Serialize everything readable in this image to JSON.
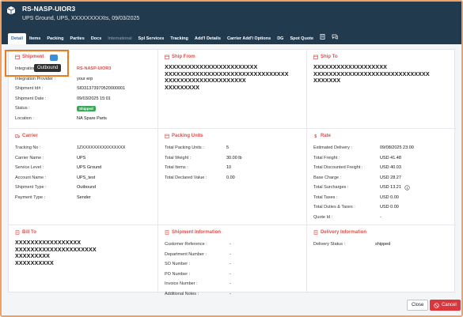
{
  "header": {
    "title": "RS-NASP-UIOR3",
    "subtitle": "UPS Ground, UPS, XXXXXXXXXts, 09/03/2025"
  },
  "tabs": [
    "Detail",
    "Items",
    "Packing",
    "Parties",
    "Docs",
    "International",
    "Spl Services",
    "Tracking",
    "Add'l Details",
    "Carrier Add'l Options",
    "DG",
    "Spot Quote"
  ],
  "shipment": {
    "title": "Shipment",
    "tooltip": "Outbound",
    "rows": [
      {
        "label": "Integration",
        "value": "RS-NASP-UIOR3"
      },
      {
        "label": "Integration Provider :",
        "value": "your erp"
      },
      {
        "label": "Shipment Id# :",
        "value": "SID31373970520000001"
      },
      {
        "label": "Shipment Date :",
        "value": "09/03/2025 15:01"
      },
      {
        "label": "Status :",
        "value": "Shipped"
      },
      {
        "label": "Location :",
        "value": "NA Spare Parts"
      }
    ]
  },
  "ship_from": {
    "title": "Ship From",
    "lines": [
      "XXXXXXXXXXXXXXXXXXXXXXXX",
      "XXXXXXXXXXXXXXXXXXXXXXXXXXXXXXXX",
      "XXXXXXXXXXXXXXXXXXXXX",
      "XXXXXXXXX"
    ]
  },
  "ship_to": {
    "title": "Ship To",
    "lines": [
      "XXXXXXXXXXXXXXXXXXX",
      "XXXXXXXXXXXXXXXXXXXXXXXXXXXXXX",
      "XXXXXXX"
    ]
  },
  "carrier": {
    "title": "Carrier",
    "rows": [
      {
        "label": "Tracking No :",
        "value": "1ZXXXXXXXXXXXXXXX"
      },
      {
        "label": "Carrier Name :",
        "value": "UPS"
      },
      {
        "label": "Service Level :",
        "value": "UPS Ground"
      },
      {
        "label": "Account Name :",
        "value": "UPS_test"
      },
      {
        "label": "Shipment Type :",
        "value": "Outbound"
      },
      {
        "label": "Payment Type :",
        "value": "Sender"
      }
    ]
  },
  "packing": {
    "title": "Packing Units",
    "rows": [
      {
        "label": "Total Packing Units :",
        "value": "5"
      },
      {
        "label": "Total Weight :",
        "value": "30.00 lb"
      },
      {
        "label": "Total Items :",
        "value": "10"
      },
      {
        "label": "Total Declared Value :",
        "value": "0.00"
      }
    ]
  },
  "rate": {
    "title": "Rate",
    "rows": [
      {
        "label": "Estimated Delivery :",
        "value": "09/08/2025 23:00"
      },
      {
        "label": "Total Freight :",
        "value": "USD 41.48"
      },
      {
        "label": "Total Discounted Freight :",
        "value": "USD 40.03"
      },
      {
        "label": "Base Charge :",
        "value": "USD 28.27"
      },
      {
        "label": "Total Surcharges :",
        "value": "USD 13.21"
      },
      {
        "label": "Total Taxes :",
        "value": "USD 0.00"
      },
      {
        "label": "Total Duties & Taxes :",
        "value": "USD 0.00"
      },
      {
        "label": "Quote Id :",
        "value": "-"
      }
    ]
  },
  "bill_to": {
    "title": "Bill To",
    "lines": [
      "XXXXXXXXXXXXXXXXX",
      "XXXXXXXXXXXXXXXXXXXXX",
      "XXXXXXXXX",
      "XXXXXXXXXX"
    ]
  },
  "shipment_info": {
    "title": "Shipment Information",
    "rows": [
      {
        "label": "Customer Reference :",
        "value": "-"
      },
      {
        "label": "Department Number :",
        "value": "-"
      },
      {
        "label": "SO Number :",
        "value": "-"
      },
      {
        "label": "PO Number :",
        "value": "-"
      },
      {
        "label": "Invoice Number :",
        "value": "-"
      },
      {
        "label": "Additional Notes :",
        "value": "-"
      }
    ]
  },
  "delivery_info": {
    "title": "Delivery Information",
    "rows": [
      {
        "label": "Delivery Status :",
        "value": "shipped"
      }
    ]
  },
  "footer": {
    "close_label": "Close",
    "cancel_label": "Cancel"
  },
  "colors": {
    "header_bg": "#223a4e",
    "accent_red": "#d9534f",
    "status_green": "#3aa856",
    "highlight_orange": "#ec7a1e",
    "cancel_red": "#d9363e"
  }
}
